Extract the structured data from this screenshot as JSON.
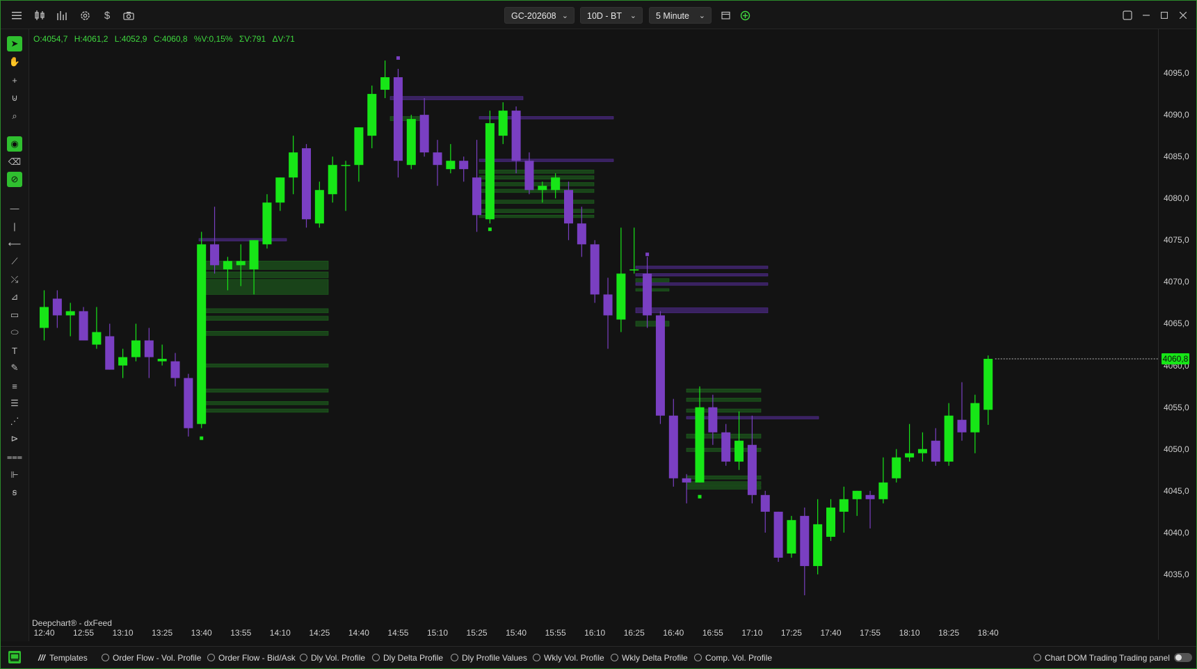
{
  "toolbar": {
    "symbol": "GC-202608",
    "range": "10D - BT",
    "interval": "5 Minute",
    "icons": [
      "menu-icon",
      "candles-icon",
      "bars-icon",
      "gear-icon",
      "dollar-icon",
      "camera-icon"
    ],
    "window_icons": [
      "restore-icon",
      "minimize-icon",
      "maximize-icon",
      "close-icon"
    ]
  },
  "left_tools": [
    "cursor-icon",
    "hand-icon",
    "crosshair-icon",
    "magnet-icon",
    "zoom-icon",
    "eye-icon",
    "eraser-icon",
    "lock-icon",
    "hline-icon",
    "vline-icon",
    "ray-icon",
    "trendline-icon",
    "path-icon",
    "ruler-icon",
    "rectangle-icon",
    "ellipse-icon",
    "text-icon",
    "pencil-icon",
    "lines-icon",
    "list-icon",
    "fib-icon",
    "fib2-icon",
    "fib3-icon",
    "profile-icon",
    "profile2-icon"
  ],
  "ohlc": {
    "open": "O:4054,7",
    "high": "H:4061,2",
    "low": "L:4052,9",
    "close": "C:4060,8",
    "pct": "%V:0,15%",
    "sumv": "ΣV:791",
    "deltav": "ΔV:71"
  },
  "source_label": "Deepchart® - dxFeed",
  "last_price": "4060,8",
  "colors": {
    "up": "#17e617",
    "down": "#7a3fc2",
    "volume": "#1f6b1f",
    "volume_purple": "#5a2fa0",
    "background": "#131313"
  },
  "bottom": {
    "templates_label": "Templates",
    "templates": [
      "Order Flow - Vol. Profile",
      "Order Flow - Bid/Ask",
      "Dly Vol. Profile",
      "Dly Delta Profile",
      "Dly Profile Values",
      "Wkly Vol. Profile",
      "Wkly Delta Profile",
      "Comp. Vol. Profile"
    ],
    "chart_dom": "Chart DOM Trading",
    "trading_panel": "Trading panel"
  },
  "chart_data": {
    "type": "candlestick",
    "y_ticks": [
      "4095,0",
      "4090,0",
      "4085,0",
      "4080,0",
      "4075,0",
      "4070,0",
      "4065,0",
      "4060,0",
      "4055,0",
      "4050,0",
      "4045,0",
      "4040,0",
      "4035,0"
    ],
    "y_range": [
      4032,
      4097.5
    ],
    "x_ticks": [
      "12:40",
      "12:55",
      "13:10",
      "13:25",
      "13:40",
      "13:55",
      "14:10",
      "14:25",
      "14:40",
      "14:55",
      "15:10",
      "15:25",
      "15:40",
      "15:55",
      "16:10",
      "16:25",
      "16:40",
      "16:55",
      "17:10",
      "17:25",
      "17:40",
      "17:55",
      "18:10",
      "18:25",
      "18:40"
    ],
    "candles": [
      {
        "o": 4064.5,
        "h": 4069.0,
        "l": 4063.0,
        "c": 4067.0
      },
      {
        "o": 4068.0,
        "h": 4069.0,
        "l": 4064.5,
        "c": 4066.0
      },
      {
        "o": 4066.0,
        "h": 4067.5,
        "l": 4063.5,
        "c": 4066.5
      },
      {
        "o": 4066.5,
        "h": 4067.0,
        "l": 4063.0,
        "c": 4063.0
      },
      {
        "o": 4062.5,
        "h": 4067.0,
        "l": 4062.0,
        "c": 4064.0
      },
      {
        "o": 4063.5,
        "h": 4065.0,
        "l": 4059.5,
        "c": 4059.5
      },
      {
        "o": 4060.0,
        "h": 4062.0,
        "l": 4058.5,
        "c": 4061.0
      },
      {
        "o": 4061.0,
        "h": 4065.0,
        "l": 4060.5,
        "c": 4063.0
      },
      {
        "o": 4063.0,
        "h": 4064.5,
        "l": 4058.5,
        "c": 4061.0
      },
      {
        "o": 4060.5,
        "h": 4062.5,
        "l": 4060.0,
        "c": 4060.8
      },
      {
        "o": 4060.5,
        "h": 4061.5,
        "l": 4057.5,
        "c": 4058.5
      },
      {
        "o": 4058.5,
        "h": 4059.0,
        "l": 4051.5,
        "c": 4052.5
      },
      {
        "o": 4053.0,
        "h": 4076.0,
        "l": 4052.5,
        "c": 4074.5
      },
      {
        "o": 4074.5,
        "h": 4079.0,
        "l": 4071.0,
        "c": 4072.0
      },
      {
        "o": 4071.5,
        "h": 4073.0,
        "l": 4069.0,
        "c": 4072.5
      },
      {
        "o": 4072.0,
        "h": 4074.5,
        "l": 4069.5,
        "c": 4072.5
      },
      {
        "o": 4071.5,
        "h": 4075.0,
        "l": 4068.5,
        "c": 4075.0
      },
      {
        "o": 4074.5,
        "h": 4080.5,
        "l": 4074.0,
        "c": 4079.5
      },
      {
        "o": 4079.5,
        "h": 4082.5,
        "l": 4078.5,
        "c": 4082.5
      },
      {
        "o": 4082.5,
        "h": 4087.5,
        "l": 4080.5,
        "c": 4085.5
      },
      {
        "o": 4086.0,
        "h": 4086.5,
        "l": 4076.5,
        "c": 4077.5
      },
      {
        "o": 4077.0,
        "h": 4082.0,
        "l": 4076.5,
        "c": 4081.0
      },
      {
        "o": 4080.5,
        "h": 4085.0,
        "l": 4079.5,
        "c": 4084.0
      },
      {
        "o": 4084.0,
        "h": 4084.5,
        "l": 4078.5,
        "c": 4084.0
      },
      {
        "o": 4084.0,
        "h": 4088.0,
        "l": 4082.0,
        "c": 4088.5
      },
      {
        "o": 4087.5,
        "h": 4093.5,
        "l": 4086.0,
        "c": 4092.5
      },
      {
        "o": 4093.0,
        "h": 4096.5,
        "l": 4092.0,
        "c": 4094.5
      },
      {
        "o": 4094.5,
        "h": 4095.5,
        "l": 4082.5,
        "c": 4084.5
      },
      {
        "o": 4084.0,
        "h": 4090.0,
        "l": 4083.5,
        "c": 4089.5
      },
      {
        "o": 4090.0,
        "h": 4092.0,
        "l": 4085.0,
        "c": 4085.5
      },
      {
        "o": 4085.5,
        "h": 4087.0,
        "l": 4081.5,
        "c": 4084.0
      },
      {
        "o": 4083.5,
        "h": 4086.5,
        "l": 4083.0,
        "c": 4084.5
      },
      {
        "o": 4084.5,
        "h": 4085.0,
        "l": 4082.0,
        "c": 4083.5
      },
      {
        "o": 4082.5,
        "h": 4087.0,
        "l": 4076.0,
        "c": 4078.0
      },
      {
        "o": 4077.5,
        "h": 4090.5,
        "l": 4077.0,
        "c": 4089.0
      },
      {
        "o": 4087.5,
        "h": 4091.5,
        "l": 4086.5,
        "c": 4090.5
      },
      {
        "o": 4090.5,
        "h": 4091.0,
        "l": 4083.0,
        "c": 4084.5
      },
      {
        "o": 4084.5,
        "h": 4085.5,
        "l": 4080.5,
        "c": 4081.0
      },
      {
        "o": 4081.0,
        "h": 4082.0,
        "l": 4079.5,
        "c": 4081.5
      },
      {
        "o": 4081.0,
        "h": 4083.0,
        "l": 4080.0,
        "c": 4082.5
      },
      {
        "o": 4081.0,
        "h": 4082.0,
        "l": 4075.0,
        "c": 4077.0
      },
      {
        "o": 4077.0,
        "h": 4079.0,
        "l": 4073.0,
        "c": 4074.5
      },
      {
        "o": 4074.5,
        "h": 4075.0,
        "l": 4067.5,
        "c": 4068.5
      },
      {
        "o": 4068.5,
        "h": 4070.5,
        "l": 4062.0,
        "c": 4066.0
      },
      {
        "o": 4065.5,
        "h": 4076.5,
        "l": 4064.0,
        "c": 4071.0
      },
      {
        "o": 4071.5,
        "h": 4076.5,
        "l": 4071.0,
        "c": 4071.5
      },
      {
        "o": 4071.0,
        "h": 4073.0,
        "l": 4064.5,
        "c": 4066.0
      },
      {
        "o": 4066.0,
        "h": 4066.5,
        "l": 4053.0,
        "c": 4054.0
      },
      {
        "o": 4054.0,
        "h": 4056.0,
        "l": 4045.5,
        "c": 4046.5
      },
      {
        "o": 4046.5,
        "h": 4047.0,
        "l": 4043.5,
        "c": 4046.0
      },
      {
        "o": 4046.0,
        "h": 4057.5,
        "l": 4046.0,
        "c": 4055.0
      },
      {
        "o": 4055.0,
        "h": 4056.5,
        "l": 4050.5,
        "c": 4052.0
      },
      {
        "o": 4052.0,
        "h": 4053.0,
        "l": 4048.0,
        "c": 4048.5
      },
      {
        "o": 4048.5,
        "h": 4054.5,
        "l": 4047.5,
        "c": 4051.0
      },
      {
        "o": 4050.5,
        "h": 4054.0,
        "l": 4043.5,
        "c": 4044.5
      },
      {
        "o": 4044.5,
        "h": 4045.0,
        "l": 4040.0,
        "c": 4042.5
      },
      {
        "o": 4042.5,
        "h": 4042.5,
        "l": 4036.5,
        "c": 4037.0
      },
      {
        "o": 4037.5,
        "h": 4042.0,
        "l": 4037.0,
        "c": 4041.5
      },
      {
        "o": 4042.0,
        "h": 4043.0,
        "l": 4032.5,
        "c": 4036.0
      },
      {
        "o": 4036.0,
        "h": 4044.0,
        "l": 4035.0,
        "c": 4041.0
      },
      {
        "o": 4039.5,
        "h": 4044.0,
        "l": 4039.0,
        "c": 4043.0
      },
      {
        "o": 4042.5,
        "h": 4045.5,
        "l": 4040.0,
        "c": 4044.0
      },
      {
        "o": 4044.0,
        "h": 4045.0,
        "l": 4042.0,
        "c": 4045.0
      },
      {
        "o": 4044.5,
        "h": 4045.0,
        "l": 4040.5,
        "c": 4044.0
      },
      {
        "o": 4044.0,
        "h": 4049.0,
        "l": 4043.5,
        "c": 4046.0
      },
      {
        "o": 4046.5,
        "h": 4050.0,
        "l": 4046.0,
        "c": 4049.0
      },
      {
        "o": 4049.0,
        "h": 4053.0,
        "l": 4048.5,
        "c": 4049.5
      },
      {
        "o": 4049.5,
        "h": 4052.0,
        "l": 4048.5,
        "c": 4050.0
      },
      {
        "o": 4051.0,
        "h": 4052.5,
        "l": 4048.0,
        "c": 4048.5
      },
      {
        "o": 4048.5,
        "h": 4055.5,
        "l": 4048.0,
        "c": 4054.0
      },
      {
        "o": 4053.5,
        "h": 4058.0,
        "l": 4051.0,
        "c": 4052.0
      },
      {
        "o": 4052.0,
        "h": 4056.5,
        "l": 4049.5,
        "c": 4055.5
      },
      {
        "o": 4054.7,
        "h": 4061.2,
        "l": 4052.9,
        "c": 4060.8
      }
    ],
    "profiles": [
      {
        "x0": 244,
        "x1": 430,
        "bars": [
          [
            4071.5,
            4072.5
          ],
          [
            4070.5,
            4071.2
          ],
          [
            4068.5,
            4070.3
          ],
          [
            4066.3,
            4066.8
          ],
          [
            4065.4,
            4065.9
          ],
          [
            4063.6,
            4064.1
          ],
          [
            4059.8,
            4060.2
          ],
          [
            4056.8,
            4057.2
          ],
          [
            4055.3,
            4055.7
          ],
          [
            4054.4,
            4054.8
          ]
        ],
        "color": "volume"
      },
      {
        "x0": 244,
        "x1": 370,
        "bars": [
          [
            4074.9,
            4075.2
          ]
        ],
        "color": "volume_purple"
      },
      {
        "x0": 519,
        "x1": 710,
        "bars": [
          [
            4091.8,
            4092.2
          ]
        ],
        "color": "volume_purple"
      },
      {
        "x0": 519,
        "x1": 570,
        "bars": [
          [
            4089.3,
            4089.8
          ]
        ],
        "color": "volume"
      },
      {
        "x0": 647,
        "x1": 840,
        "bars": [
          [
            4089.5,
            4089.8
          ],
          [
            4084.4,
            4084.7
          ]
        ],
        "color": "volume_purple"
      },
      {
        "x0": 647,
        "x1": 812,
        "bars": [
          [
            4083.0,
            4083.4
          ],
          [
            4082.3,
            4082.7
          ],
          [
            4081.5,
            4081.9
          ],
          [
            4080.7,
            4081.1
          ],
          [
            4079.4,
            4079.8
          ],
          [
            4078.3,
            4078.7
          ],
          [
            4077.7,
            4078.0
          ]
        ],
        "color": "volume"
      },
      {
        "x0": 872,
        "x1": 1062,
        "bars": [
          [
            4071.6,
            4071.9
          ],
          [
            4070.7,
            4071.0
          ],
          [
            4069.6,
            4069.9
          ],
          [
            4066.3,
            4066.9
          ]
        ],
        "color": "volume_purple"
      },
      {
        "x0": 872,
        "x1": 920,
        "bars": [
          [
            4070.0,
            4070.4
          ],
          [
            4068.9,
            4069.2
          ],
          [
            4064.7,
            4065.3
          ]
        ],
        "color": "volume"
      },
      {
        "x0": 945,
        "x1": 1052,
        "bars": [
          [
            4056.8,
            4057.2
          ],
          [
            4055.7,
            4056.1
          ],
          [
            4054.4,
            4054.8
          ],
          [
            4046.4,
            4046.8
          ],
          [
            4045.7,
            4046.1
          ],
          [
            4045.2,
            4045.6
          ]
        ],
        "color": "volume"
      },
      {
        "x0": 945,
        "x1": 1135,
        "bars": [
          [
            4053.6,
            4053.9
          ]
        ],
        "color": "volume_purple"
      },
      {
        "x0": 945,
        "x1": 1052,
        "bars": [
          [
            4051.3,
            4051.8
          ],
          [
            4049.7,
            4050.1
          ]
        ],
        "color": "volume"
      }
    ],
    "markers": [
      {
        "i": 12,
        "y": 4051.3,
        "color": "up"
      },
      {
        "i": 27,
        "y": 4096.8,
        "color": "down"
      },
      {
        "i": 34,
        "y": 4076.3,
        "color": "up"
      },
      {
        "i": 46,
        "y": 4073.3,
        "color": "down"
      },
      {
        "i": 50,
        "y": 4044.3,
        "color": "up"
      }
    ]
  }
}
